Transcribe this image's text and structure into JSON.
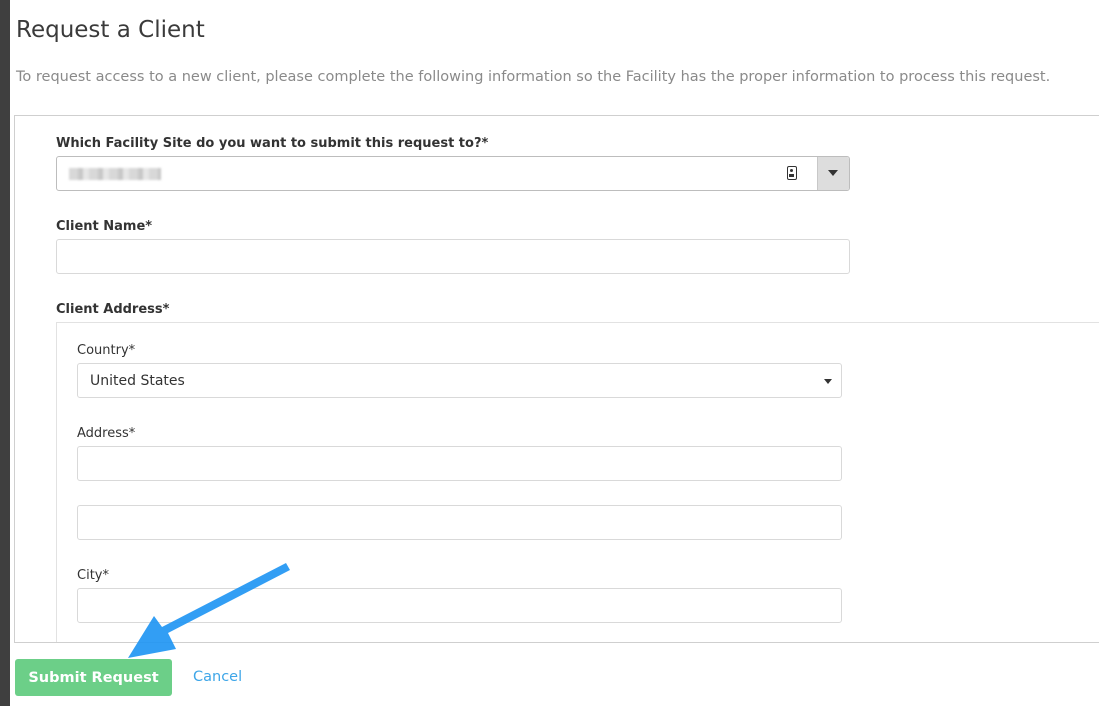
{
  "page": {
    "title": "Request a Client",
    "intro": "To request access to a new client, please complete the following information so the Facility has the proper information to process this request."
  },
  "form": {
    "facility_site": {
      "label": "Which Facility Site do you want to submit this request to?*",
      "value_redacted": true
    },
    "client_name": {
      "label": "Client Name*",
      "value": ""
    },
    "client_address": {
      "label": "Client Address*",
      "country": {
        "label": "Country*",
        "value": "United States"
      },
      "address": {
        "label": "Address*",
        "line1": "",
        "line2": ""
      },
      "city": {
        "label": "City*",
        "value": ""
      }
    }
  },
  "actions": {
    "submit_label": "Submit Request",
    "cancel_label": "Cancel"
  },
  "colors": {
    "submit_button": "#6ccf88",
    "link": "#3ea6e8",
    "annotation_arrow": "#2196f3"
  },
  "icons": {
    "site_field": "contact-card-icon",
    "dropdown": "chevron-down-icon"
  }
}
